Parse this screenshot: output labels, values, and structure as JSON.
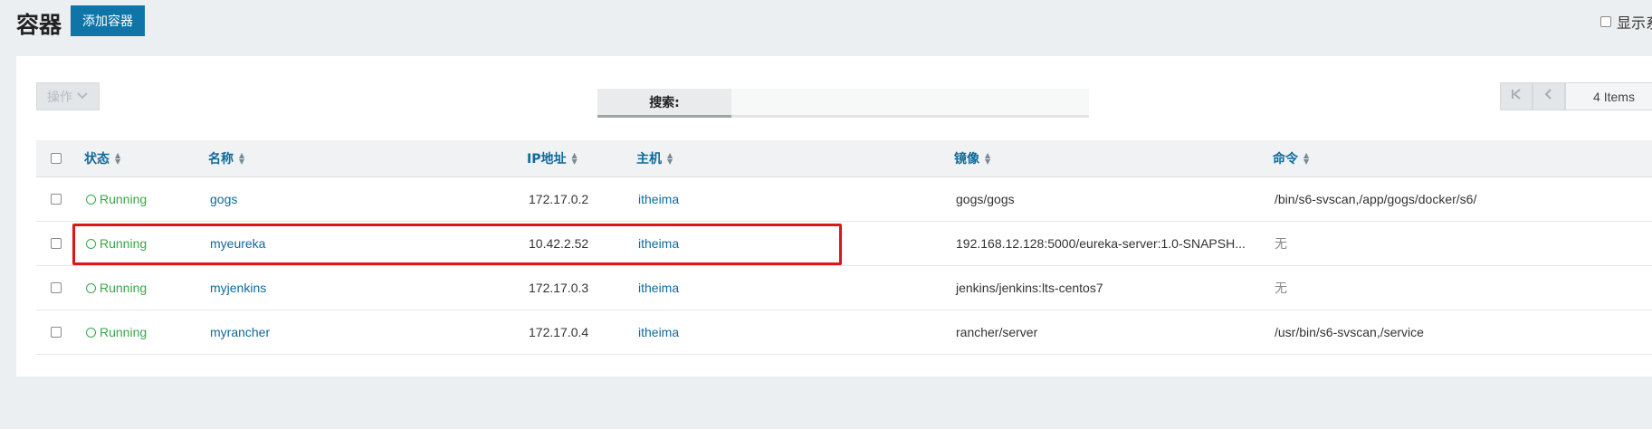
{
  "header": {
    "title": "容器",
    "add_button": "添加容器",
    "show_all_label": "显示系"
  },
  "toolbar": {
    "actions_label": "操作",
    "search_label": "搜索:",
    "search_value": "",
    "pager_count": "4 Items"
  },
  "table": {
    "columns": [
      "状态",
      "名称",
      "IP地址",
      "主机",
      "镜像",
      "命令"
    ],
    "rows": [
      {
        "status": "Running",
        "name": "gogs",
        "ip": "172.17.0.2",
        "host": "itheima",
        "image": "gogs/gogs",
        "command": "/bin/s6-svscan,/app/gogs/docker/s6/"
      },
      {
        "status": "Running",
        "name": "myeureka",
        "ip": "10.42.2.52",
        "host": "itheima",
        "image": "192.168.12.128:5000/eureka-server:1.0-SNAPSH...",
        "command": "无"
      },
      {
        "status": "Running",
        "name": "myjenkins",
        "ip": "172.17.0.3",
        "host": "itheima",
        "image": "jenkins/jenkins:lts-centos7",
        "command": "无"
      },
      {
        "status": "Running",
        "name": "myrancher",
        "ip": "172.17.0.4",
        "host": "itheima",
        "image": "rancher/server",
        "command": "/usr/bin/s6-svscan,/service"
      }
    ]
  },
  "icons": {
    "sort": "sort-icon",
    "status": "circle-outline-icon",
    "chevron_down": "chevron-down-icon",
    "first_page": "first-page-icon",
    "prev_page": "chevron-left-icon",
    "next_page": "chevron-right-icon"
  },
  "colors": {
    "accent": "#0f75a8",
    "running": "#3aa64a",
    "highlight": "#e01616"
  }
}
